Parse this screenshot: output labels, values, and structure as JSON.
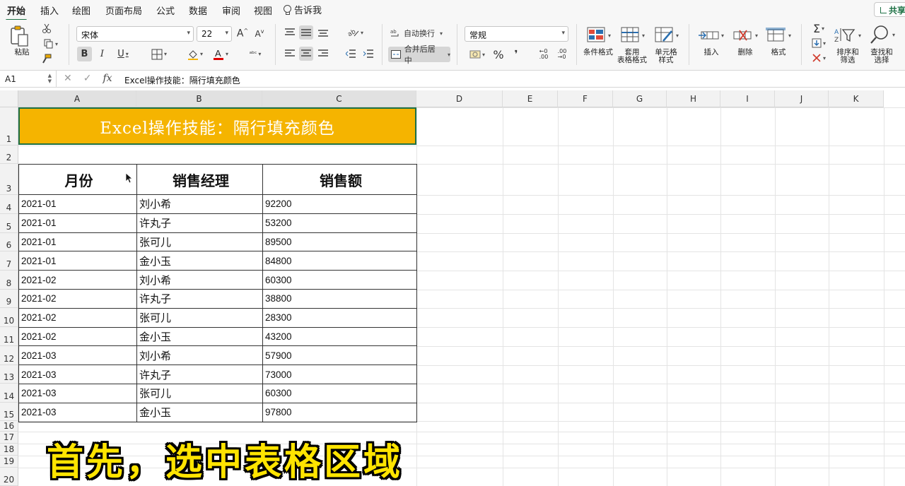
{
  "menu": {
    "tabs": [
      "开始",
      "插入",
      "绘图",
      "页面布局",
      "公式",
      "数据",
      "审阅",
      "视图"
    ],
    "tell_me": "告诉我",
    "share": "共享"
  },
  "ribbon": {
    "paste_label": "粘贴",
    "font_name": "宋体",
    "font_size": "22",
    "bold": "B",
    "italic": "I",
    "underline": "U",
    "wrap_text": "自动换行",
    "merge_center": "合并后居中",
    "number_format": "常规",
    "percent": "%",
    "comma": "❜",
    "cond_format": "条件格式",
    "table_format": "套用\n表格格式",
    "cell_style": "单元格\n样式",
    "insert": "插入",
    "delete": "删除",
    "format": "格式",
    "sort_filter": "排序和\n筛选",
    "find_select": "查找和\n选择"
  },
  "formula_bar": {
    "name_box": "A1",
    "fx": "fx",
    "content": "Excel操作技能：隔行填充颜色"
  },
  "columns": [
    "A",
    "B",
    "C",
    "D",
    "E",
    "F",
    "G",
    "H",
    "I",
    "J",
    "K"
  ],
  "rows": [
    "1",
    "2",
    "3",
    "4",
    "5",
    "6",
    "7",
    "8",
    "9",
    "10",
    "11",
    "12",
    "13",
    "14",
    "15",
    "16",
    "17",
    "18",
    "19",
    "20"
  ],
  "sheet": {
    "title": "Excel操作技能：隔行填充颜色",
    "headers": [
      "月份",
      "销售经理",
      "销售额"
    ],
    "data": [
      [
        "2021-01",
        "刘小希",
        "92200"
      ],
      [
        "2021-01",
        "许丸子",
        "53200"
      ],
      [
        "2021-01",
        "张可儿",
        "89500"
      ],
      [
        "2021-01",
        "金小玉",
        "84800"
      ],
      [
        "2021-02",
        "刘小希",
        "60300"
      ],
      [
        "2021-02",
        "许丸子",
        "38800"
      ],
      [
        "2021-02",
        "张可儿",
        "28300"
      ],
      [
        "2021-02",
        "金小玉",
        "43200"
      ],
      [
        "2021-03",
        "刘小希",
        "57900"
      ],
      [
        "2021-03",
        "许丸子",
        "73000"
      ],
      [
        "2021-03",
        "张可儿",
        "60300"
      ],
      [
        "2021-03",
        "金小玉",
        "97800"
      ]
    ]
  },
  "caption": "首先，选中表格区域",
  "colors": {
    "title_fill": "#f5b400",
    "accent": "#1e7145",
    "caption": "#ffe400"
  }
}
